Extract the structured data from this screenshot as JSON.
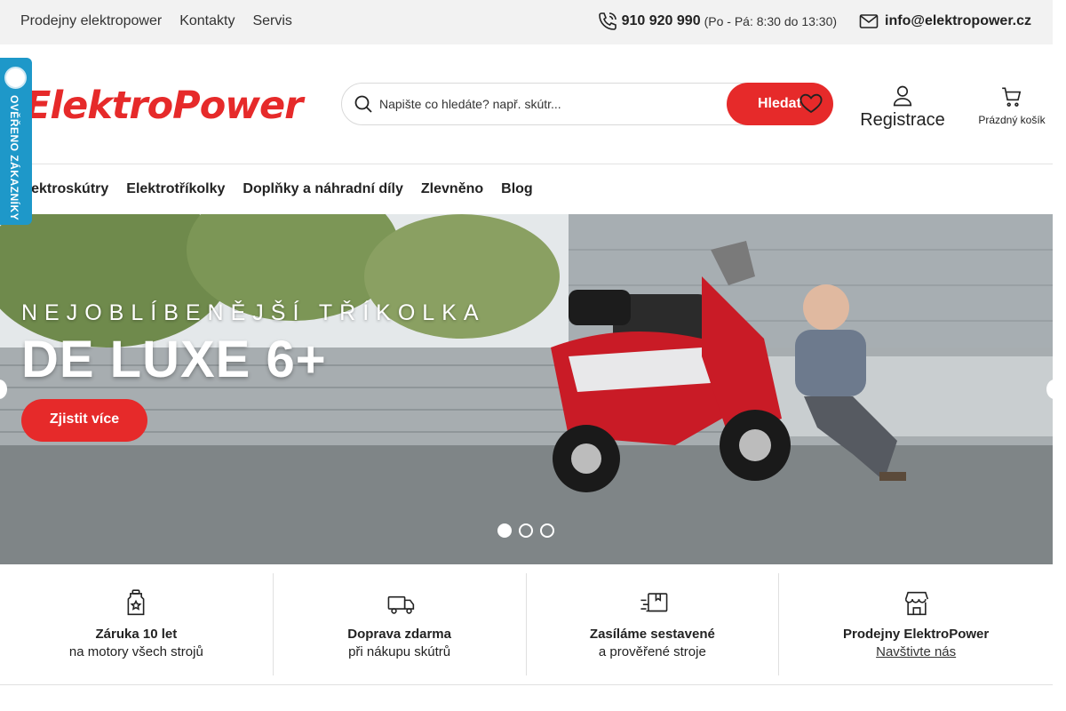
{
  "topbar": {
    "links": [
      "Prodejny elektropower",
      "Kontakty",
      "Servis"
    ],
    "phone": "910 920 990",
    "hours": "(Po - Pá: 8:30 do 13:30)",
    "email": "info@elektropower.cz"
  },
  "header": {
    "logo": "ElektroPower",
    "search_placeholder": "Napište co hledáte? např. skútr...",
    "search_button": "Hledat",
    "register_label": "Registrace",
    "cart_label": "Prázdný košík"
  },
  "badge": {
    "text": "OVĚŘENO ZÁKAZNÍKY"
  },
  "nav": {
    "items": [
      "Elektroskútry",
      "Elektrotříkolky",
      "Doplňky a náhradní díly",
      "Zlevněno",
      "Blog"
    ]
  },
  "hero": {
    "subtitle": "NEJOBLÍBENĚJŠÍ TŘÍKOLKA",
    "title": "DE LUXE 6+",
    "button": "Zjistit více",
    "slides": 3,
    "active_slide": 1
  },
  "features": [
    {
      "title": "Záruka 10 let",
      "text": "na motory všech strojů",
      "icon": "shield-star-icon"
    },
    {
      "title": "Doprava zdarma",
      "text": "při nákupu skútrů",
      "icon": "truck-icon"
    },
    {
      "title": "Zasíláme sestavené",
      "text": "a prověřené stroje",
      "icon": "box-icon"
    },
    {
      "title": "Prodejny ElektroPower",
      "text": "Navštivte nás",
      "icon": "store-icon"
    }
  ],
  "colors": {
    "accent": "#e62a2a",
    "badge": "#1e98c9"
  }
}
